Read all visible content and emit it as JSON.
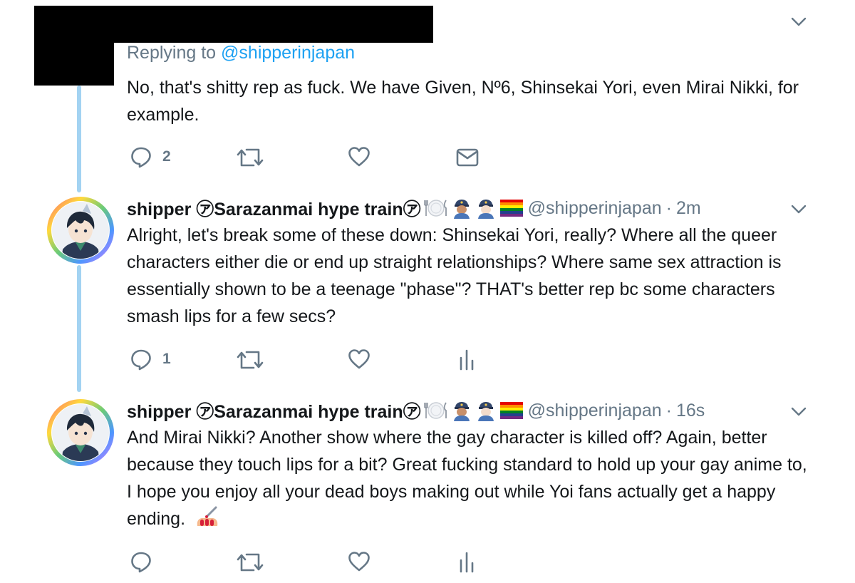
{
  "replying_block": {
    "replying_prefix": "Replying to",
    "replying_handle": "@shipperinjapan",
    "text": "No, that's shitty rep as fuck. We have Given, Nº6, Shinsekai Yori, even Mirai Nikki, for example.",
    "actions": {
      "reply_count": "2"
    }
  },
  "tweets": [
    {
      "display_name": "shipper ㋐Sarazanmai hype train㋐",
      "handle": "@shipperinjapan",
      "separator": "·",
      "time": "2m",
      "text": "Alright, let's break some of these down: Shinsekai Yori, really? Where all the queer characters either die or end up straight relationships? Where same sex attraction is essentially shown to be a teenage \"phase\"? THAT's better rep bc some characters smash lips for a few secs?",
      "reply_count": "1"
    },
    {
      "display_name": "shipper ㋐Sarazanmai hype train㋐",
      "handle": "@shipperinjapan",
      "separator": "·",
      "time": "16s",
      "text": "And Mirai Nikki? Another show where the gay character is killed off? Again, better because they touch lips for a bit? Great fucking standard to hold up your gay anime to, I hope you enjoy all your dead boys making out while Yoi fans actually get a happy ending.",
      "reply_count": ""
    }
  ],
  "icons": {
    "reply": "reply-icon",
    "retweet": "retweet-icon",
    "like": "like-icon",
    "dm": "envelope-icon",
    "analytics": "analytics-icon",
    "caret": "chevron-down-icon",
    "name_emojis": [
      "fork-knife-plate-emoji",
      "police-officer-emoji",
      "police-officer-emoji",
      "rainbow-flag-emoji"
    ],
    "end_emoji": "nail-polish-emoji"
  },
  "colors": {
    "text": "#14171a",
    "muted": "#657786",
    "link": "#1da1f2",
    "thread_line": "#a3d3f2",
    "icon": "#657786"
  }
}
